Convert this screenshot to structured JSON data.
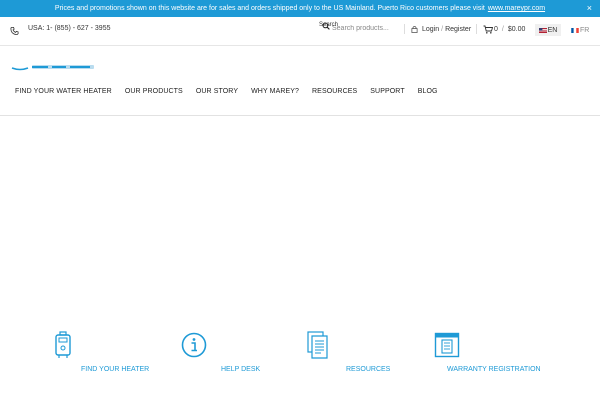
{
  "promo": {
    "text": "Prices and promotions shown on this website are for sales and orders shipped only to the US Mainland. Puerto Rico customers please visit",
    "link": "www.mareypr.com",
    "close": "×"
  },
  "topbar": {
    "phone": "USA: 1- (855) - 627 - 3955",
    "search_placeholder": "Search products...",
    "search_button": "Search",
    "login": "Login",
    "login_sep": "/",
    "register": "Register",
    "cart_count": "0",
    "cart_sep": "/",
    "cart_total": "$0.00",
    "lang_en": "EN",
    "lang_fr": "FR"
  },
  "nav": {
    "items": [
      "FIND YOUR WATER HEATER",
      "OUR PRODUCTS",
      "OUR STORY",
      "WHY MAREY?",
      "RESOURCES",
      "SUPPORT",
      "BLOG"
    ]
  },
  "features": [
    {
      "label": "FIND YOUR HEATER",
      "icon": "water-heater-icon"
    },
    {
      "label": "HELP DESK",
      "icon": "info-icon"
    },
    {
      "label": "RESOURCES",
      "icon": "documents-icon"
    },
    {
      "label": "WARRANTY REGISTRATION",
      "icon": "warranty-certificate-icon"
    }
  ],
  "colors": {
    "accent": "#1e9ad6",
    "text": "#222222"
  }
}
